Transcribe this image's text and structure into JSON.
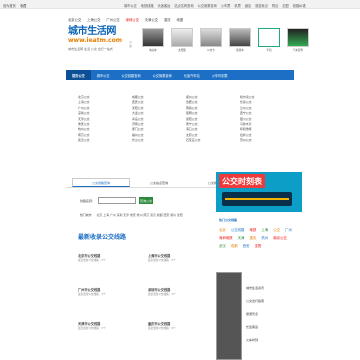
{
  "topbar": {
    "left_links": [
      "设为首页",
      "收藏"
    ],
    "right_links": [
      "城市公交",
      "地铁线路",
      "长途客运",
      "站点名称查询",
      "公交换乘查询",
      "火车票",
      "机票",
      "酒店",
      "旅游景点",
      "附近",
      "加盟",
      "线路纠错"
    ]
  },
  "subnav": {
    "items": [
      "北京公交",
      "上海公交",
      "广州公交",
      "深圳公交",
      "天津公交",
      "重庆",
      "地图"
    ],
    "hot_index": 3
  },
  "logo": {
    "line1": "城市生活网",
    "line2": "www.ieatm.com",
    "badge": "公交",
    "tagline": "城市生活网 生活 公交 出行一站式"
  },
  "thumbs": [
    {
      "caption": "电动车",
      "icon": "ebike-image"
    },
    {
      "caption": "太阳能",
      "icon": "solar-image"
    },
    {
      "caption": "公交卡",
      "icon": "card-image"
    },
    {
      "caption": "旅游车",
      "icon": "bus-image"
    },
    {
      "caption": "手机",
      "icon": "phone-image"
    },
    {
      "caption": "汽车配件",
      "icon": "parts-image"
    }
  ],
  "mainnav": {
    "items": [
      "首页公交",
      "城市公交",
      "公交线路查询",
      "公交换乘查询",
      "长途汽车站",
      "火车时刻表"
    ],
    "active_index": 0
  },
  "dir": {
    "columns": [
      [
        "北京公交",
        "上海公交",
        "广州公交",
        "深圳公交",
        "天津公交",
        "重庆公交",
        "杭州公交",
        "南京公交",
        "武汉公交"
      ],
      [
        "成都公交",
        "西安公交",
        "沈阳公交",
        "大连公交",
        "青岛公交",
        "济南公交",
        "厦门公交",
        "福州公交",
        "长沙公交"
      ],
      [
        "郑州公交",
        "合肥公交",
        "南昌公交",
        "昆明公交",
        "贵阳公交",
        "南宁公交",
        "海口公交",
        "太原公交",
        "石家庄公交"
      ],
      [
        "哈尔滨公交",
        "长春公交",
        "兰州公交",
        "西宁公交",
        "银川公交",
        "乌鲁木齐",
        "呼和浩特",
        "拉萨公交",
        "苏州公交"
      ]
    ]
  },
  "section_label": "城市公交",
  "tabs": {
    "items": [
      "公交线路查询",
      "公交站点查询",
      "公交换乘查询"
    ],
    "active_index": 0
  },
  "search": {
    "label": "线路名称：",
    "placeholder": "",
    "button": "查询公交"
  },
  "hotline": {
    "label": "热门城市",
    "cities": "北京 上海 广州 深圳 天津 重庆 杭州 南京 武汉 成都 西安 郑州 沈阳"
  },
  "bigtitle": "最新收录公交线路",
  "cities": [
    {
      "name": "北京市公交线路",
      "meta": "最近更新公交线路：2个"
    },
    {
      "name": "上海市公交线路",
      "meta": "最近更新公交线路：2个"
    },
    {
      "name": "广州市公交线路",
      "meta": "最近更新公交线路：3个"
    },
    {
      "name": "深圳市公交线路",
      "meta": "最近更新公交线路：2个"
    },
    {
      "name": "天津市公交线路",
      "meta": "最近更新公交线路：2个"
    },
    {
      "name": "重庆市公交线路",
      "meta": "最近更新公交线路：4个"
    }
  ],
  "sidebar": {
    "banner_title": "公交时刻表",
    "title": "热门公交线路",
    "tags": [
      {
        "text": "北京",
        "color": "#e67e00"
      },
      {
        "text": "公交线路",
        "color": "#1c6fc4"
      },
      {
        "text": "地铁",
        "color": "#e00"
      },
      {
        "text": "上海",
        "color": "#2a8a3a"
      },
      {
        "text": "公交",
        "color": "#e67e00"
      },
      {
        "text": "广州",
        "color": "#1c6fc4"
      },
      {
        "text": "深圳地铁",
        "color": "#e00"
      },
      {
        "text": "天津",
        "color": "#2a8a3a"
      },
      {
        "text": "重庆",
        "color": "#e67e00"
      },
      {
        "text": "杭州",
        "color": "#1c6fc4"
      },
      {
        "text": "南京公交",
        "color": "#e00"
      },
      {
        "text": "武汉",
        "color": "#2a8a3a"
      },
      {
        "text": "成都",
        "color": "#e67e00"
      },
      {
        "text": "西安",
        "color": "#1c6fc4"
      },
      {
        "text": "沈阳",
        "color": "#e00"
      }
    ]
  },
  "bottomad": {
    "items": [
      "城市生活资讯",
      "公交出行指南",
      "旅游景点",
      "长途客运",
      "火车时刻"
    ]
  }
}
